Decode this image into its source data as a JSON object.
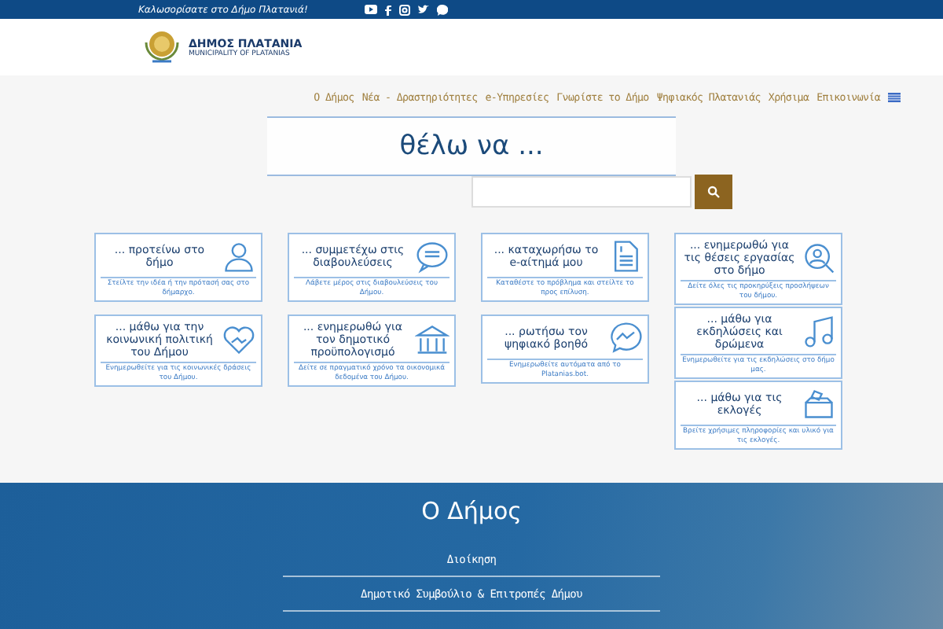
{
  "top_bar": {
    "welcome": "Καλωσορίσατε στο Δήμο Πλατανιά!"
  },
  "logo": {
    "title": "ΔΗΜΟΣ ΠΛΑΤΑΝΙΑ",
    "subtitle": "MUNICIPALITY OF PLATANIAS"
  },
  "nav": {
    "items": [
      {
        "label": "Ο Δήμος"
      },
      {
        "label": "Νέα - Δραστηριότητες"
      },
      {
        "label": "e-Υπηρεσίες"
      },
      {
        "label": "Γνωρίστε το Δήμο"
      },
      {
        "label": "Ψηφιακός Πλατανιάς"
      },
      {
        "label": "Χρήσιμα"
      },
      {
        "label": "Επικοινωνία"
      }
    ]
  },
  "hero": {
    "banner": "θέλω να ..."
  },
  "card_columns": [
    {
      "cards": [
        {
          "kind": "person",
          "title": "... προτείνω στο δήμο",
          "description": "Στείλτε την ιδέα ή την πρότασή σας στο δήμαρχο."
        },
        {
          "kind": "heart",
          "title": "... μάθω για την κοινωνική πολιτική του Δήμου",
          "description": "Ενημερωθείτε για τις κοινωνικές δράσεις του Δήμου."
        }
      ]
    },
    {
      "cards": [
        {
          "kind": "chat",
          "title": "... συμμετέχω στις διαβουλεύσεις",
          "description": "Λάβετε μέρος στις διαβουλεύσεις του Δήμου."
        },
        {
          "kind": "building",
          "title": "... ενημερωθώ για τον δημοτικό προϋπολογισμό",
          "description": "Δείτε σε πραγματικό χρόνο τα οικονομικά δεδομένα του Δήμου."
        }
      ]
    },
    {
      "cards": [
        {
          "kind": "document",
          "title": "... καταχωρήσω το e-αίτημά μου",
          "description": "Καταθέστε το πρόβλημα και στείλτε το προς επίλυση."
        },
        {
          "kind": "messenger",
          "title": "... ρωτήσω τον ψηφιακό βοηθό",
          "description": "Ενημερωθείτε αυτόματα από το Platanias.bot."
        }
      ]
    },
    {
      "cards": [
        {
          "kind": "search",
          "title": "... ενημερωθώ για τις θέσεις εργασίας στο δήμο",
          "description": "Δείτε όλες τις προκηρύξεις προσλήψεων του δήμου."
        },
        {
          "kind": "music",
          "title": "... μάθω για εκδηλώσεις και δρώμενα",
          "description": "Ενημερωθείτε για τις εκδηλώσεις στο δήμο μας."
        },
        {
          "kind": "ballot",
          "title": "... μάθω για τις εκλογές",
          "description": "Βρείτε χρήσιμες πληροφορίες και υλικό για τις εκλογές."
        }
      ]
    }
  ],
  "footer": {
    "title": "Ο Δήμος",
    "links": [
      {
        "label": "Διοίκηση"
      },
      {
        "label": "Δημοτικό Συμβούλιο & Επιτροπές Δήμου"
      }
    ]
  }
}
